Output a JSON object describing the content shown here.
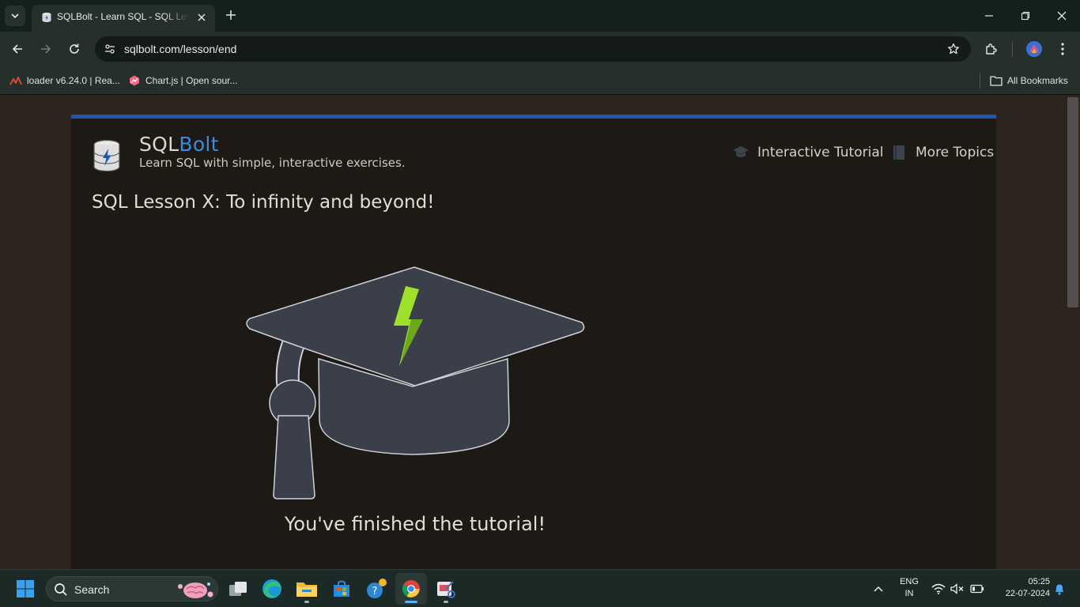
{
  "browser": {
    "tab_title": "SQLBolt - Learn SQL - SQL Lesson X: To infinity and beyond!",
    "url": "sqlbolt.com/lesson/end",
    "bookmarks": [
      {
        "label": "loader v6.24.0 | Rea..."
      },
      {
        "label": "Chart.js | Open sour..."
      }
    ],
    "all_bookmarks_label": "All Bookmarks"
  },
  "page": {
    "brand_prefix": "SQL",
    "brand_suffix": "Bolt",
    "tagline": "Learn SQL with simple, interactive exercises.",
    "nav": {
      "tutorial_label": "Interactive Tutorial",
      "topics_label": "More Topics"
    },
    "lesson_title": "SQL Lesson X: To infinity and beyond!",
    "finished_text": "You've finished the tutorial!"
  },
  "taskbar": {
    "search_label": "Search",
    "lang_line1": "ENG",
    "lang_line2": "IN",
    "time": "05:25",
    "date": "22-07-2024"
  },
  "colors": {
    "accent": "#1e57b2",
    "brand_accent": "#3a8be0",
    "bolt": "#9ee02a",
    "cap": "#3b3f4a"
  }
}
